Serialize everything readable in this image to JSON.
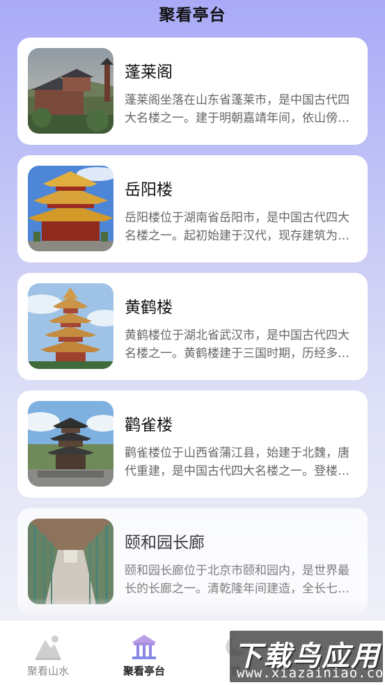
{
  "header": {
    "title": "聚看亭台"
  },
  "cards": [
    {
      "title": "蓬莱阁",
      "desc": "蓬莱阁坐落在山东省蓬莱市，是中国古代四大名楼之一。建于明朝嘉靖年间，依山傍海，景色壮丽。",
      "image": "penglai-pavilion-photo"
    },
    {
      "title": "岳阳楼",
      "desc": "岳阳楼位于湖南省岳阳市，是中国古代四大名楼之一。起初始建于汉代，现存建筑为清代重修。",
      "image": "yueyang-tower-photo"
    },
    {
      "title": "黄鹤楼",
      "desc": "黄鹤楼位于湖北省武汉市，是中国古代四大名楼之一。黄鹤楼建于三国时期，历经多次重建。",
      "image": "yellow-crane-tower-photo"
    },
    {
      "title": "鹳雀楼",
      "desc": "鹳雀楼位于山西省蒲江县，始建于北魏，唐代重建，是中国古代四大名楼之一。登楼远眺，风光无限。",
      "image": "guanque-tower-photo"
    },
    {
      "title": "颐和园长廊",
      "desc": "颐和园长廊位于北京市颐和园内，是世界最长的长廊之一。清乾隆年间建造，全长七百余米。",
      "image": "long-corridor-photo"
    }
  ],
  "tabbar": {
    "tabs": [
      {
        "label": "聚看山水",
        "icon": "mountain-icon",
        "active": false
      },
      {
        "label": "聚看亭台",
        "icon": "pavilion-icon",
        "active": true
      },
      {
        "label": "梦",
        "icon": "dream-icon",
        "active": false
      }
    ]
  },
  "watermark": {
    "big": "下载鸟应用",
    "small": "www.xiazainiao.com"
  }
}
